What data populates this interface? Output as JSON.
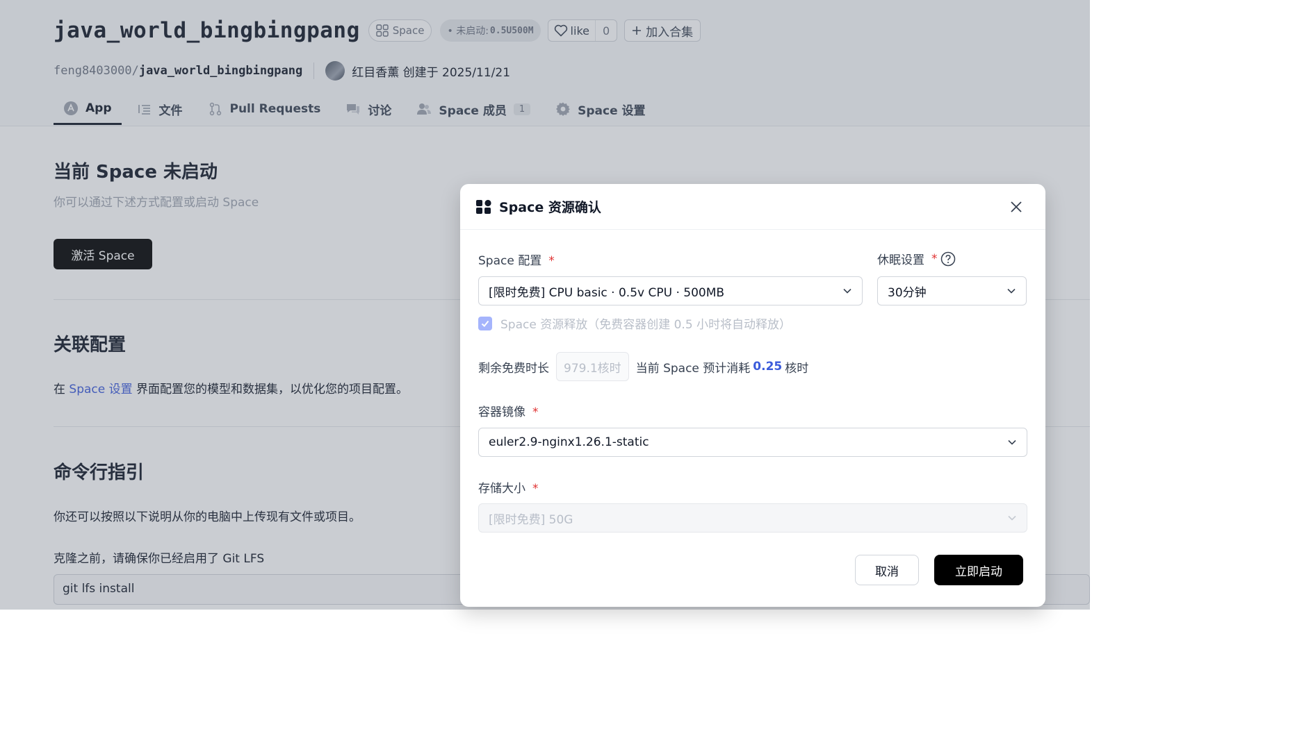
{
  "header": {
    "repo_title": "java_world_bingbingpang",
    "space_badge": "Space",
    "status_prefix": "• 未启动:",
    "status_value": "0.5U500M",
    "like_label": "like",
    "like_count": "0",
    "collect_label": "加入合集",
    "path_owner": "feng8403000/",
    "path_name": "java_world_bingbingpang",
    "creator_text": "红目香薰 创建于 2025/11/21"
  },
  "tabs": [
    {
      "label": "App",
      "icon": "app-icon"
    },
    {
      "label": "文件",
      "icon": "file-list-icon"
    },
    {
      "label": "Pull Requests",
      "icon": "pull-request-icon"
    },
    {
      "label": "讨论",
      "icon": "discussion-icon"
    },
    {
      "label": "Space 成员",
      "icon": "members-icon",
      "badge": "1"
    },
    {
      "label": "Space 设置",
      "icon": "gear-icon"
    }
  ],
  "main": {
    "not_started_title": "当前 Space 未启动",
    "not_started_subtitle": "你可以通过下述方式配置或启动 Space",
    "activate_button": "激活 Space",
    "related_title": "关联配置",
    "related_prefix": "在 ",
    "related_link": "Space 设置",
    "related_suffix": " 界面配置您的模型和数据集，以优化您的项目配置。",
    "cli_title": "命令行指引",
    "cli_text": "你还可以按照以下说明从你的电脑中上传现有文件或项目。",
    "clone_text": "克隆之前，请确保你已经启用了 Git LFS",
    "code_line": "git lfs install"
  },
  "modal": {
    "title": "Space 资源确认",
    "config_label": "Space 配置",
    "config_value": "[限时免费] CPU basic · 0.5v CPU · 500MB",
    "sleep_label": "休眠设置",
    "sleep_value": "30分钟",
    "release_checkbox": "Space 资源释放（免费容器创建 0.5 小时将自动释放）",
    "quota_label": "剩余免费时长",
    "quota_value": "979.1核时",
    "estimate_prefix": "当前 Space 预计消耗",
    "estimate_value": "0.25",
    "estimate_unit": "核时",
    "image_label": "容器镜像",
    "image_value": "euler2.9-nginx1.26.1-static",
    "storage_label": "存储大小",
    "storage_value": "[限时免费] 50G",
    "required_mark": "*",
    "cancel_button": "取消",
    "start_button": "立即启动"
  },
  "colors": {
    "accent": "#3b5bdb",
    "required": "#e03131",
    "primary_button": "#000000"
  }
}
